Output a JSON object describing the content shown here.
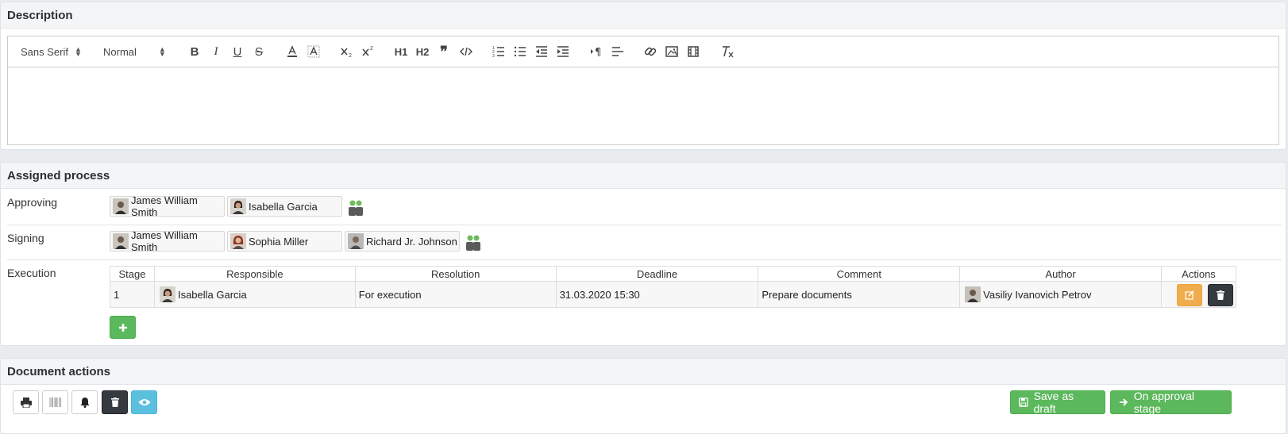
{
  "description": {
    "title": "Description",
    "toolbar": {
      "font_family": "Sans Serif",
      "font_size": "Normal",
      "h1": "H1",
      "h2": "H2"
    }
  },
  "process": {
    "title": "Assigned process",
    "approving": {
      "label": "Approving",
      "people": [
        "James William Smith",
        "Isabella Garcia"
      ]
    },
    "signing": {
      "label": "Signing",
      "people": [
        "James William Smith",
        "Sophia Miller",
        "Richard Jr. Johnson"
      ]
    },
    "execution": {
      "label": "Execution",
      "columns": [
        "Stage",
        "Responsible",
        "Resolution",
        "Deadline",
        "Comment",
        "Author",
        "Actions"
      ],
      "rows": [
        {
          "stage": "1",
          "responsible": "Isabella Garcia",
          "resolution": "For execution",
          "deadline": "31.03.2020 15:30",
          "comment": "Prepare documents",
          "author": "Vasiliy Ivanovich Petrov"
        }
      ]
    }
  },
  "actions": {
    "title": "Document actions",
    "save_draft": "Save as draft",
    "approval_stage": "On approval stage"
  },
  "colors": {
    "success": "#5cb85c",
    "warning": "#f0ad4e",
    "dark": "#343a40",
    "info": "#5bc0de"
  }
}
